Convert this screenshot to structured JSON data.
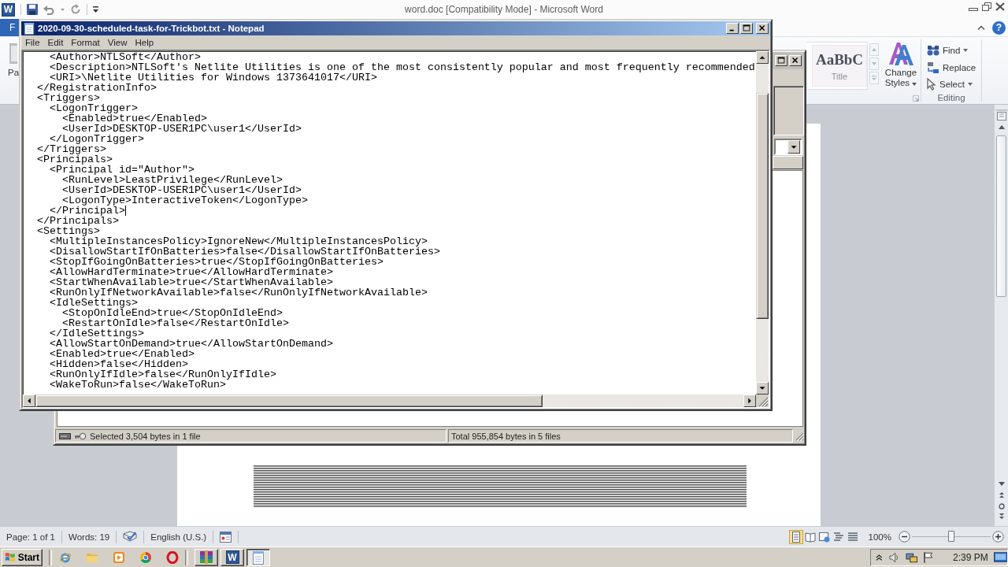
{
  "word": {
    "app_logo": "W",
    "title": "word.doc [Compatibility Mode] - Microsoft Word",
    "file_tab": "F",
    "help": "?",
    "paste_label": "Pa",
    "styles": {
      "preview": "AaBbC",
      "name": "Title",
      "change_styles": "Change Styles"
    },
    "editing": {
      "label": "Editing",
      "commands": [
        {
          "label": "Find",
          "dropdown": true
        },
        {
          "label": "Replace",
          "dropdown": false
        },
        {
          "label": "Select",
          "dropdown": true
        }
      ]
    },
    "status_bar": {
      "page": "Page: 1 of 1",
      "words": "Words: 19",
      "language": "English (U.S.)",
      "views": [
        {
          "kind": "print",
          "selected": true
        },
        {
          "kind": "reading",
          "selected": false
        },
        {
          "kind": "web",
          "selected": false
        },
        {
          "kind": "outline",
          "selected": false
        },
        {
          "kind": "draft",
          "selected": false
        }
      ],
      "zoom": "100%",
      "zoom_slider": {
        "level": 0.5
      }
    }
  },
  "explorer": {
    "status_selected": "Selected 3,504 bytes in 1 file",
    "status_total": "Total 955,854 bytes in 5 files"
  },
  "notepad": {
    "title": "2020-09-30-scheduled-task-for-Trickbot.txt - Notepad",
    "menu": [
      "File",
      "Edit",
      "Format",
      "View",
      "Help"
    ],
    "lines": [
      {
        "text": "    <Author>NTLSoft</Author>",
        "caret": false
      },
      {
        "text": "    <Description>NTLSoft's Netlite Utilities is one of the most consistently popular and most frequently recommended",
        "caret": false
      },
      {
        "text": "    <URI>\\Netlite Utilities for Windows 1373641017</URI>",
        "caret": false
      },
      {
        "text": "  </RegistrationInfo>",
        "caret": false
      },
      {
        "text": "  <Triggers>",
        "caret": false
      },
      {
        "text": "    <LogonTrigger>",
        "caret": false
      },
      {
        "text": "      <Enabled>true</Enabled>",
        "caret": false
      },
      {
        "text": "      <UserId>DESKTOP-USER1PC\\user1</UserId>",
        "caret": false
      },
      {
        "text": "    </LogonTrigger>",
        "caret": false
      },
      {
        "text": "  </Triggers>",
        "caret": false
      },
      {
        "text": "  <Principals>",
        "caret": false
      },
      {
        "text": "    <Principal id=\"Author\">",
        "caret": false
      },
      {
        "text": "      <RunLevel>LeastPrivilege</RunLevel>",
        "caret": false
      },
      {
        "text": "      <UserId>DESKTOP-USER1PC\\user1</UserId>",
        "caret": false
      },
      {
        "text": "      <LogonType>InteractiveToken</LogonType>",
        "caret": false
      },
      {
        "text": "    </Principal>",
        "caret": true
      },
      {
        "text": "  </Principals>",
        "caret": false
      },
      {
        "text": "  <Settings>",
        "caret": false
      },
      {
        "text": "    <MultipleInstancesPolicy>IgnoreNew</MultipleInstancesPolicy>",
        "caret": false
      },
      {
        "text": "    <DisallowStartIfOnBatteries>false</DisallowStartIfOnBatteries>",
        "caret": false
      },
      {
        "text": "    <StopIfGoingOnBatteries>true</StopIfGoingOnBatteries>",
        "caret": false
      },
      {
        "text": "    <AllowHardTerminate>true</AllowHardTerminate>",
        "caret": false
      },
      {
        "text": "    <StartWhenAvailable>true</StartWhenAvailable>",
        "caret": false
      },
      {
        "text": "    <RunOnlyIfNetworkAvailable>false</RunOnlyIfNetworkAvailable>",
        "caret": false
      },
      {
        "text": "    <IdleSettings>",
        "caret": false
      },
      {
        "text": "      <StopOnIdleEnd>true</StopOnIdleEnd>",
        "caret": false
      },
      {
        "text": "      <RestartOnIdle>false</RestartOnIdle>",
        "caret": false
      },
      {
        "text": "    </IdleSettings>",
        "caret": false
      },
      {
        "text": "    <AllowStartOnDemand>true</AllowStartOnDemand>",
        "caret": false
      },
      {
        "text": "    <Enabled>true</Enabled>",
        "caret": false
      },
      {
        "text": "    <Hidden>false</Hidden>",
        "caret": false
      },
      {
        "text": "    <RunOnlyIfIdle>false</RunOnlyIfIdle>",
        "caret": false
      },
      {
        "text": "    <WakeToRun>false</WakeToRun>",
        "caret": false
      }
    ]
  },
  "taskbar": {
    "start": "Start",
    "tasks": [
      {
        "kind": "archive",
        "selected": false
      },
      {
        "kind": "word",
        "logo": "W",
        "selected": false
      },
      {
        "kind": "notepad",
        "selected": true
      }
    ],
    "clock": "2:39 PM"
  }
}
